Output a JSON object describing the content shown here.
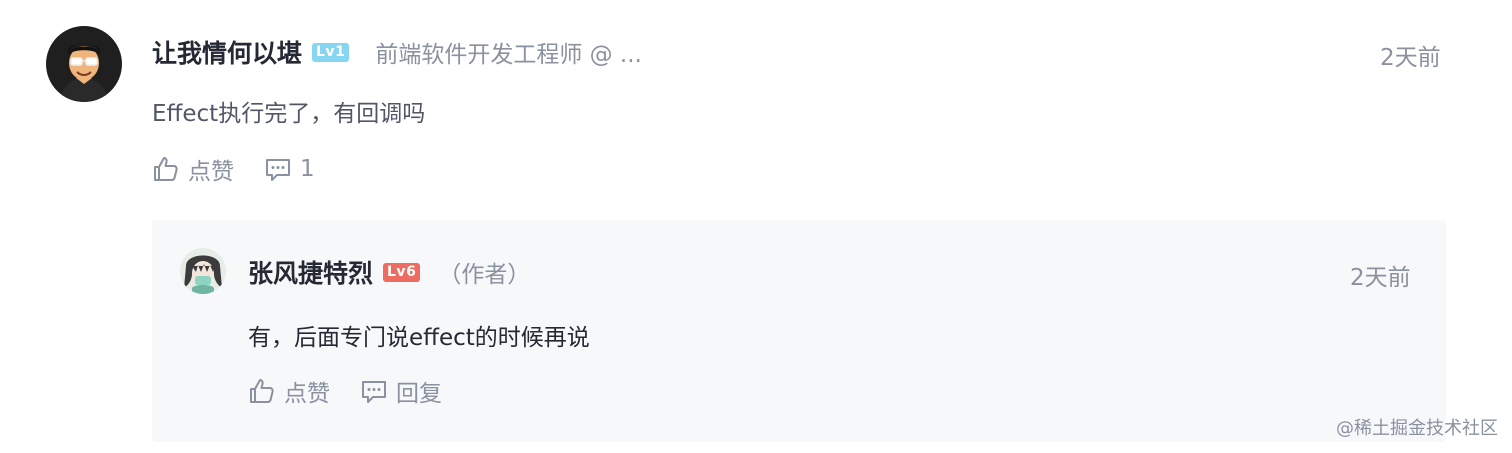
{
  "comment": {
    "author": {
      "name": "让我情何以堪",
      "level": "Lv1",
      "job": "前端软件开发工程师 @ ...",
      "avatar_icon": "avatar-man-glasses"
    },
    "time": "2天前",
    "text": "Effect执行完了，有回调吗",
    "actions": {
      "like_icon": "thumbs-up-icon",
      "like_label": "点赞",
      "comment_icon": "comment-icon",
      "comment_count": "1"
    }
  },
  "reply": {
    "author": {
      "name": "张风捷特烈",
      "level": "Lv6",
      "tag": "（作者）",
      "avatar_icon": "avatar-anime"
    },
    "time": "2天前",
    "text": "有，后面专门说effect的时候再说",
    "actions": {
      "like_icon": "thumbs-up-icon",
      "like_label": "点赞",
      "reply_icon": "comment-icon",
      "reply_label": "回复"
    }
  },
  "watermark": "@稀土掘金技术社区",
  "colors": {
    "primary_text": "#252933",
    "secondary_text": "#8a919f",
    "body_text": "#515767",
    "reply_bg": "#f7f8fa",
    "lv1_badge": "#86d6f1",
    "lv6_badge": "#ee6b62"
  }
}
